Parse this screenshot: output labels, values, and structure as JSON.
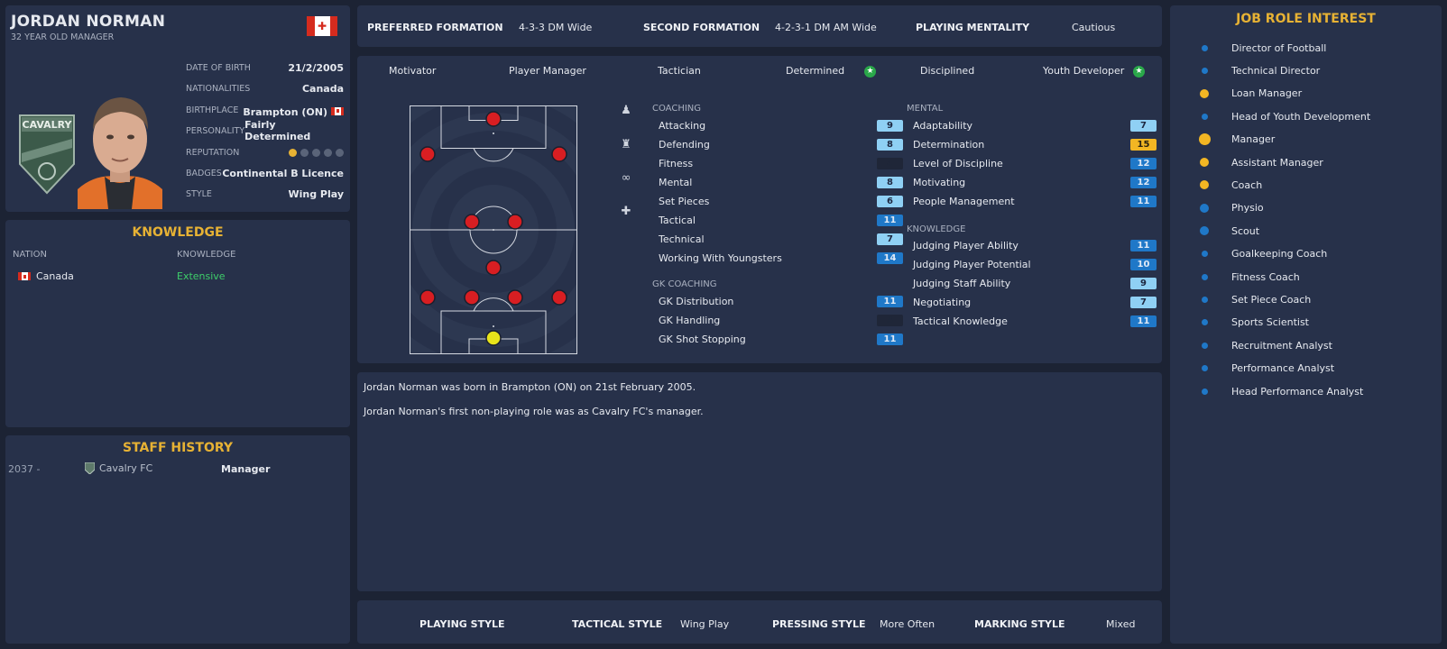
{
  "profile": {
    "name": "JORDAN NORMAN",
    "subtitle": "32 YEAR OLD MANAGER",
    "crest_text": "CAVALRY",
    "rows": [
      {
        "label": "DATE OF BIRTH",
        "value": "21/2/2005"
      },
      {
        "label": "NATIONALITIES",
        "value": "Canada"
      },
      {
        "label": "BIRTHPLACE",
        "value": "Brampton (ON)"
      },
      {
        "label": "PERSONALITY",
        "value": "Fairly Determined"
      },
      {
        "label": "REPUTATION",
        "value": ""
      },
      {
        "label": "BADGES",
        "value": "Continental B Licence"
      },
      {
        "label": "STYLE",
        "value": "Wing Play"
      }
    ],
    "reputation_stars": 1,
    "reputation_max": 5,
    "colors": {
      "accent": "#e7b234",
      "flag_red": "#d52b1e"
    }
  },
  "knowledge": {
    "title": "KNOWLEDGE",
    "col_nation": "NATION",
    "col_knowledge": "KNOWLEDGE",
    "rows": [
      {
        "nation": "Canada",
        "level": "Extensive"
      }
    ]
  },
  "history": {
    "title": "STAFF HISTORY",
    "rows": [
      {
        "years": "2037 -",
        "club": "Cavalry FC",
        "role": "Manager"
      }
    ]
  },
  "formations": {
    "preferred_label": "PREFERRED FORMATION",
    "preferred_value": "4-3-3 DM Wide",
    "second_label": "SECOND FORMATION",
    "second_value": "4-2-3-1 DM AM Wide",
    "mentality_label": "PLAYING MENTALITY",
    "mentality_value": "Cautious"
  },
  "traits": [
    {
      "label": "Motivator",
      "star": false
    },
    {
      "label": "Player Manager",
      "star": false
    },
    {
      "label": "Tactician",
      "star": false
    },
    {
      "label": "Determined",
      "star": true
    },
    {
      "label": "Disciplined",
      "star": false
    },
    {
      "label": "Youth Developer",
      "star": true
    }
  ],
  "coaching": {
    "title": "COACHING",
    "items": [
      {
        "name": "Attacking",
        "value": "9",
        "tone": "light"
      },
      {
        "name": "Defending",
        "value": "8",
        "tone": "light"
      },
      {
        "name": "Fitness",
        "value": "4",
        "tone": "dark"
      },
      {
        "name": "Mental",
        "value": "8",
        "tone": "light"
      },
      {
        "name": "Set Pieces",
        "value": "6",
        "tone": "light"
      },
      {
        "name": "Tactical",
        "value": "11",
        "tone": "blue"
      },
      {
        "name": "Technical",
        "value": "7",
        "tone": "light"
      },
      {
        "name": "Working With Youngsters",
        "value": "14",
        "tone": "blue"
      }
    ]
  },
  "gk_coaching": {
    "title": "GK COACHING",
    "items": [
      {
        "name": "GK Distribution",
        "value": "11",
        "tone": "blue"
      },
      {
        "name": "GK Handling",
        "value": "3",
        "tone": "dark"
      },
      {
        "name": "GK Shot Stopping",
        "value": "11",
        "tone": "blue"
      }
    ]
  },
  "mental": {
    "title": "MENTAL",
    "items": [
      {
        "name": "Adaptability",
        "value": "7",
        "tone": "light"
      },
      {
        "name": "Determination",
        "value": "15",
        "tone": "gold"
      },
      {
        "name": "Level of Discipline",
        "value": "12",
        "tone": "blue"
      },
      {
        "name": "Motivating",
        "value": "12",
        "tone": "blue"
      },
      {
        "name": "People Management",
        "value": "11",
        "tone": "blue"
      }
    ]
  },
  "knowledge_attrs": {
    "title": "KNOWLEDGE",
    "items": [
      {
        "name": "Judging Player Ability",
        "value": "11",
        "tone": "blue"
      },
      {
        "name": "Judging Player Potential",
        "value": "10",
        "tone": "blue"
      },
      {
        "name": "Judging Staff Ability",
        "value": "9",
        "tone": "light"
      },
      {
        "name": "Negotiating",
        "value": "7",
        "tone": "light"
      },
      {
        "name": "Tactical Knowledge",
        "value": "11",
        "tone": "blue"
      }
    ]
  },
  "bio": {
    "line1": "Jordan Norman was born in Brampton (ON) on 21st February 2005.",
    "line2": "Jordan Norman's first non-playing role was as Cavalry FC's manager."
  },
  "styles": {
    "playing_label": "PLAYING STYLE",
    "playing_value": "",
    "tactical_label": "TACTICAL STYLE",
    "tactical_value": "Wing Play",
    "pressing_label": "PRESSING STYLE",
    "pressing_value": "More Often",
    "marking_label": "MARKING STYLE",
    "marking_value": "Mixed"
  },
  "jobs": {
    "title": "JOB ROLE INTEREST",
    "items": [
      {
        "name": "Director of Football",
        "interest": "low"
      },
      {
        "name": "Technical Director",
        "interest": "low"
      },
      {
        "name": "Loan Manager",
        "interest": "medium"
      },
      {
        "name": "Head of Youth Development",
        "interest": "low"
      },
      {
        "name": "Manager",
        "interest": "high"
      },
      {
        "name": "Assistant Manager",
        "interest": "medium"
      },
      {
        "name": "Coach",
        "interest": "medium"
      },
      {
        "name": "Physio",
        "interest": "medium-low"
      },
      {
        "name": "Scout",
        "interest": "medium-low"
      },
      {
        "name": "Goalkeeping Coach",
        "interest": "low"
      },
      {
        "name": "Fitness Coach",
        "interest": "low"
      },
      {
        "name": "Set Piece Coach",
        "interest": "low"
      },
      {
        "name": "Sports Scientist",
        "interest": "low"
      },
      {
        "name": "Recruitment Analyst",
        "interest": "low"
      },
      {
        "name": "Performance Analyst",
        "interest": "low"
      },
      {
        "name": "Head Performance Analyst",
        "interest": "low"
      }
    ]
  }
}
